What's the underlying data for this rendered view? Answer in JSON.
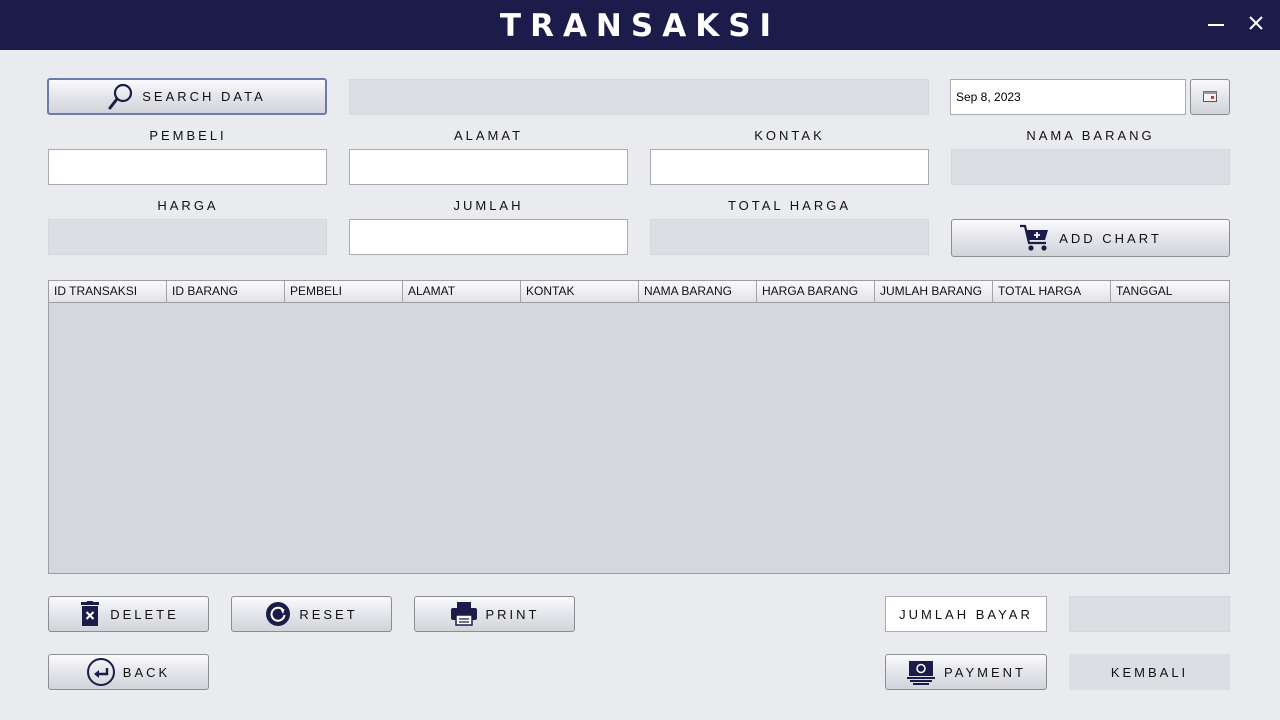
{
  "window": {
    "title": "TRANSAKSI",
    "minimize_icon": "minimize-icon",
    "close_icon": "close-icon"
  },
  "search": {
    "button_label": "SEARCH DATA",
    "icon": "search-icon",
    "value": ""
  },
  "date": {
    "value": "Sep 8, 2023",
    "icon": "calendar-icon"
  },
  "form": {
    "pembeli_label": "PEMBELI",
    "alamat_label": "ALAMAT",
    "kontak_label": "KONTAK",
    "nama_barang_label": "NAMA BARANG",
    "harga_label": "HARGA",
    "jumlah_label": "JUMLAH",
    "total_harga_label": "TOTAL HARGA",
    "pembeli_value": "",
    "alamat_value": "",
    "kontak_value": "",
    "nama_barang_value": "",
    "harga_value": "",
    "jumlah_value": "",
    "total_harga_value": ""
  },
  "add_chart": {
    "label": "ADD CHART",
    "icon": "cart-add-icon"
  },
  "table": {
    "columns": [
      "ID TRANSAKSI",
      "ID BARANG",
      "PEMBELI",
      "ALAMAT",
      "KONTAK",
      "NAMA BARANG",
      "HARGA BARANG",
      "JUMLAH BARANG",
      "TOTAL HARGA",
      "TANGGAL"
    ],
    "rows": []
  },
  "actions": {
    "delete_label": "DELETE",
    "delete_icon": "trash-icon",
    "reset_label": "RESET",
    "reset_icon": "refresh-icon",
    "print_label": "PRINT",
    "print_icon": "printer-icon",
    "back_label": "BACK",
    "back_icon": "back-arrow-icon",
    "payment_label": "PAYMENT",
    "payment_icon": "money-icon"
  },
  "payment": {
    "jumlah_bayar_label": "JUMLAH BAYAR",
    "jumlah_bayar_value": "",
    "kembali_label": "KEMBALI"
  },
  "colors": {
    "titlebar": "#1b1c4a",
    "background": "#eaebef",
    "icon": "#1b1c4a"
  }
}
